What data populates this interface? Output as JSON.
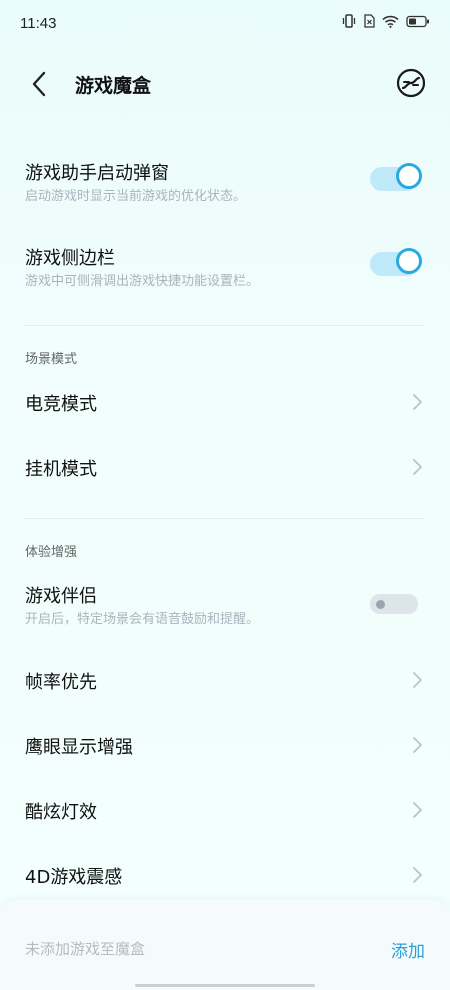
{
  "status_bar": {
    "time": "11:43"
  },
  "header": {
    "title": "游戏魔盒"
  },
  "toggles": [
    {
      "title": "游戏助手启动弹窗",
      "subtitle": "启动游戏时显示当前游戏的优化状态。",
      "on": true
    },
    {
      "title": "游戏侧边栏",
      "subtitle": "游戏中可侧滑调出游戏快捷功能设置栏。",
      "on": true
    }
  ],
  "sections": {
    "scene": {
      "label": "场景模式",
      "items": [
        "电竞模式",
        "挂机模式"
      ]
    },
    "experience": {
      "label": "体验增强",
      "companion": {
        "title": "游戏伴侣",
        "subtitle": "开启后，特定场景会有语音鼓励和提醒。",
        "on": false
      },
      "items": [
        "帧率优先",
        "鹰眼显示增强",
        "酷炫灯效",
        "4D游戏震感"
      ]
    }
  },
  "bottom_bar": {
    "text": "未添加游戏至魔盒",
    "action": "添加"
  },
  "colors": {
    "accent": "#2aa8e0",
    "background": "#eafcfb"
  }
}
